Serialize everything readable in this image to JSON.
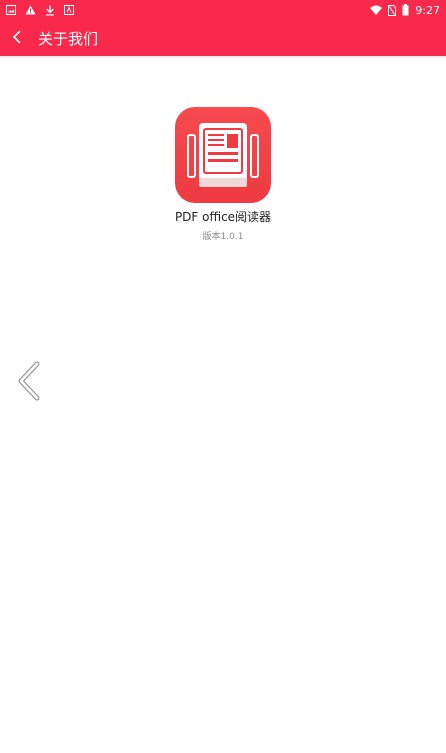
{
  "status_bar": {
    "icons_left": [
      "image-icon",
      "warning-icon",
      "download-icon",
      "app-notification-icon"
    ],
    "icons_right": [
      "wifi-icon",
      "no-sim-icon",
      "battery-icon"
    ],
    "time": "9:27"
  },
  "app_bar": {
    "back_icon": "chevron-left-icon",
    "title": "关于我们",
    "color": "#f8294b"
  },
  "about": {
    "logo_icon": "pdf-reader-logo",
    "app_name": "PDF office阅读器",
    "version": "版本1.0.1"
  },
  "overlay": {
    "side_arrow_icon": "chevron-left-icon"
  }
}
